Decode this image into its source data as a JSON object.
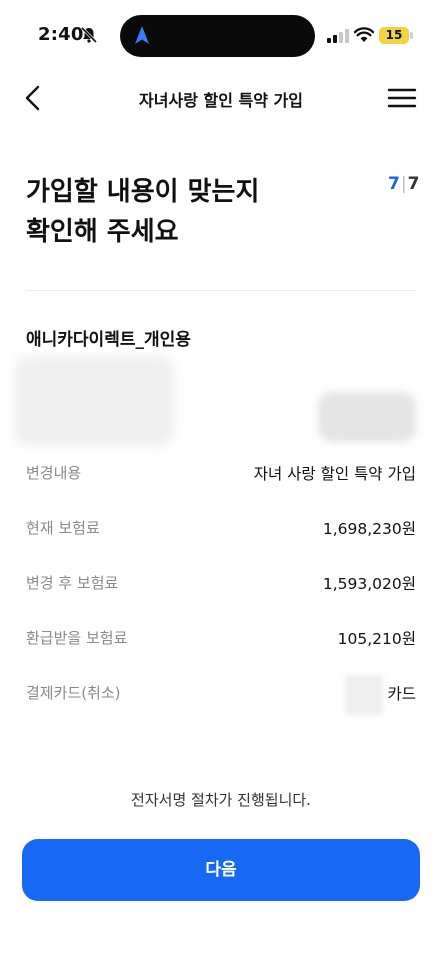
{
  "status_bar": {
    "time": "2:40",
    "battery_level": "15",
    "icons": [
      "bell-slash-icon",
      "location-arrow-icon",
      "cellular-signal-icon",
      "wifi-icon",
      "battery-icon"
    ]
  },
  "header": {
    "title": "자녀사랑 할인 특약 가입",
    "back_icon": "chevron-left-icon",
    "menu_icon": "hamburger-menu-icon"
  },
  "headline": {
    "line1": "가입할 내용이 맞는지",
    "line2": "확인해 주세요"
  },
  "step": {
    "current": "7",
    "total": "7"
  },
  "product": {
    "name": "애니카다이렉트_개인용"
  },
  "details": [
    {
      "label": "변경내용",
      "value": "자녀 사랑 할인 특약 가입"
    },
    {
      "label": "현재 보험료",
      "value": "1,698,230원"
    },
    {
      "label": "변경 후 보험료",
      "value": "1,593,020원"
    },
    {
      "label": "환급받을 보험료",
      "value": "105,210원"
    },
    {
      "label": "결제카드(취소)",
      "value": "카드"
    }
  ],
  "notice": "전자서명 절차가 진행됩니다.",
  "next_button": {
    "label": "다음"
  },
  "colors": {
    "accent": "#1668f5",
    "step_accent": "#1463f3",
    "label_gray": "#8a8a8a"
  }
}
